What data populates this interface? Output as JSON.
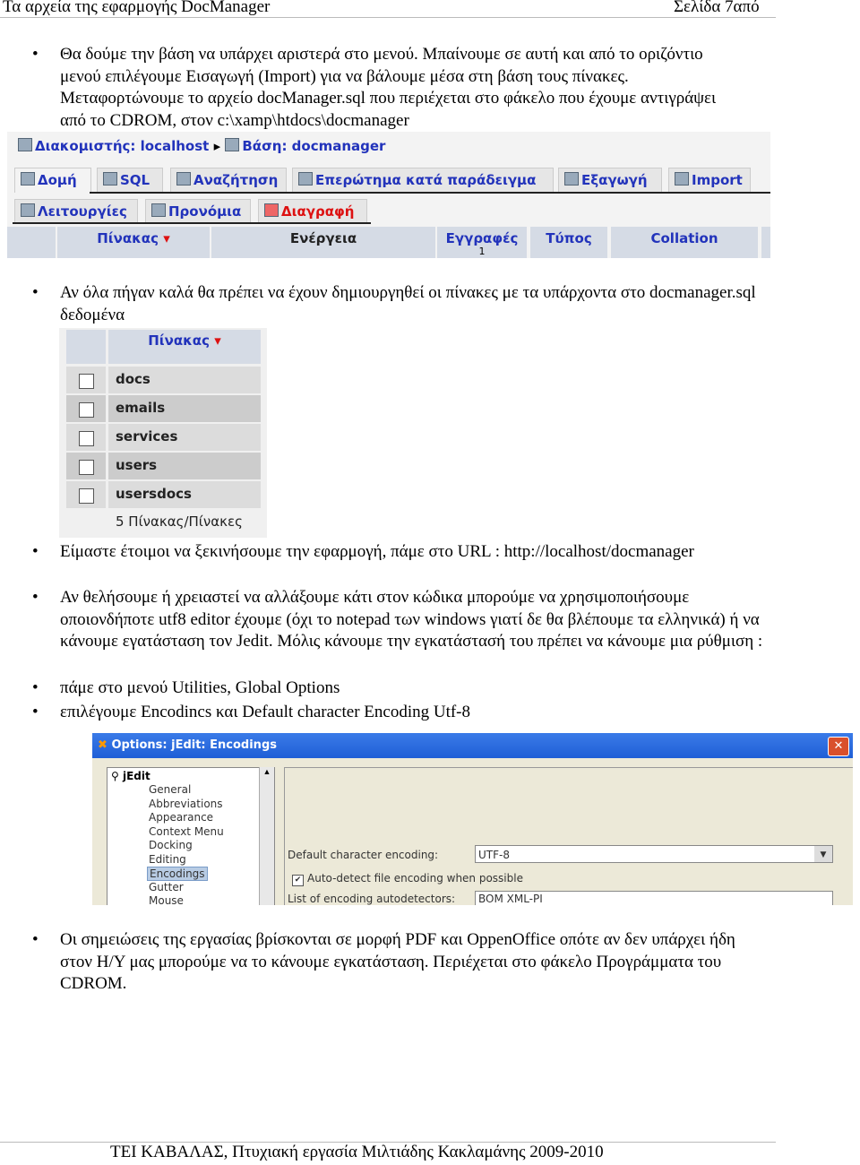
{
  "header": {
    "title": "Τα αρχεία της εφαρμογής DocManager",
    "page": "Σελίδα 7από"
  },
  "bullets": [
    "Θα δούμε την βάση να υπάρχει αριστερά στο μενού. Μπαίνουμε σε αυτή και από το οριζόντιο μενού επιλέγουμε Εισαγωγή (Import) για να βάλουμε μέσα στη βάση τους πίνακες. Μεταφορτώνουμε το αρχείο docManager.sql  που περιέχεται στο φάκελο που έχουμε αντιγράψει από το CDROM, στον c:\\xamp\\htdocs\\docmanager",
    "Αν όλα πήγαν καλά θα πρέπει να έχουν δημιουργηθεί οι πίνακες με τα υπάρχοντα στο docmanager.sql δεδομένα",
    "Είμαστε έτοιμοι να ξεκινήσουμε την εφαρμογή,   πάμε στο URL : http://localhost/docmanager",
    "Αν  θελήσουμε ή χρειαστεί να αλλάξουμε κάτι στον κώδικα μπορούμε να χρησιμοποιήσουμε οποιονδήποτε utf8 editor έχουμε (όχι το notepad των windows γιατί δε θα βλέπουμε τα ελληνικά) ή να κάνουμε εγατάσταση τον Jedit. Μόλις κάνουμε την εγκατάστασή του πρέπει να κάνουμε μια ρύθμιση :",
    "πάμε στο μενού Utilities, Global Options",
    "επιλέγουμε Encodincs και Default character Encoding Utf-8",
    "Οι σημειώσεις της εργασίας βρίσκονται σε μορφή PDF και OppenOffice οπότε  αν δεν υπάρχει ήδη στον Η/Υ μας μπορούμε να το κάνουμε εγκατάσταση. Περιέχεται στο φάκελο Προγράμματα του CDROM."
  ],
  "pma": {
    "server": "Διακομιστής: localhost",
    "db": "Βάση: docmanager",
    "tabs": [
      "Δομή",
      "SQL",
      "Αναζήτηση",
      "Επερώτημα κατά παράδειγμα",
      "Εξαγωγή",
      "Import"
    ],
    "tabs2": [
      "Λειτουργίες",
      "Προνόμια",
      "Διαγραφή"
    ],
    "cols": [
      "Πίνακας",
      "Ενέργεια",
      "Εγγραφές",
      "Τύπος",
      "Collation"
    ],
    "records_value": "1"
  },
  "tables": {
    "header": "Πίνακας",
    "rows": [
      "docs",
      "emails",
      "services",
      "users",
      "usersdocs"
    ],
    "footer": "5 Πίνακας/Πίνακες"
  },
  "jedit": {
    "title": "Options: jEdit: Encodings",
    "root": "jEdit",
    "tree": [
      "General",
      "Abbreviations",
      "Appearance",
      "Context Menu",
      "Docking",
      "Editing",
      "Encodings",
      "Gutter",
      "Mouse"
    ],
    "default_label": "Default character encoding:",
    "default_value": "UTF-8",
    "autodetect_label": "Auto-detect file encoding when possible",
    "list_label": "List of encoding autodetectors:",
    "list_value": "BOM XML-PI"
  },
  "footer": "ΤΕΙ ΚΑΒΑΛΑΣ, Πτυχιακή εργασία Μιλτιάδης Κακλαμάνης 2009-2010",
  "colors": {
    "link": "#2233bb",
    "delete": "#dd1111",
    "titlebar": "#1f5fd6"
  }
}
